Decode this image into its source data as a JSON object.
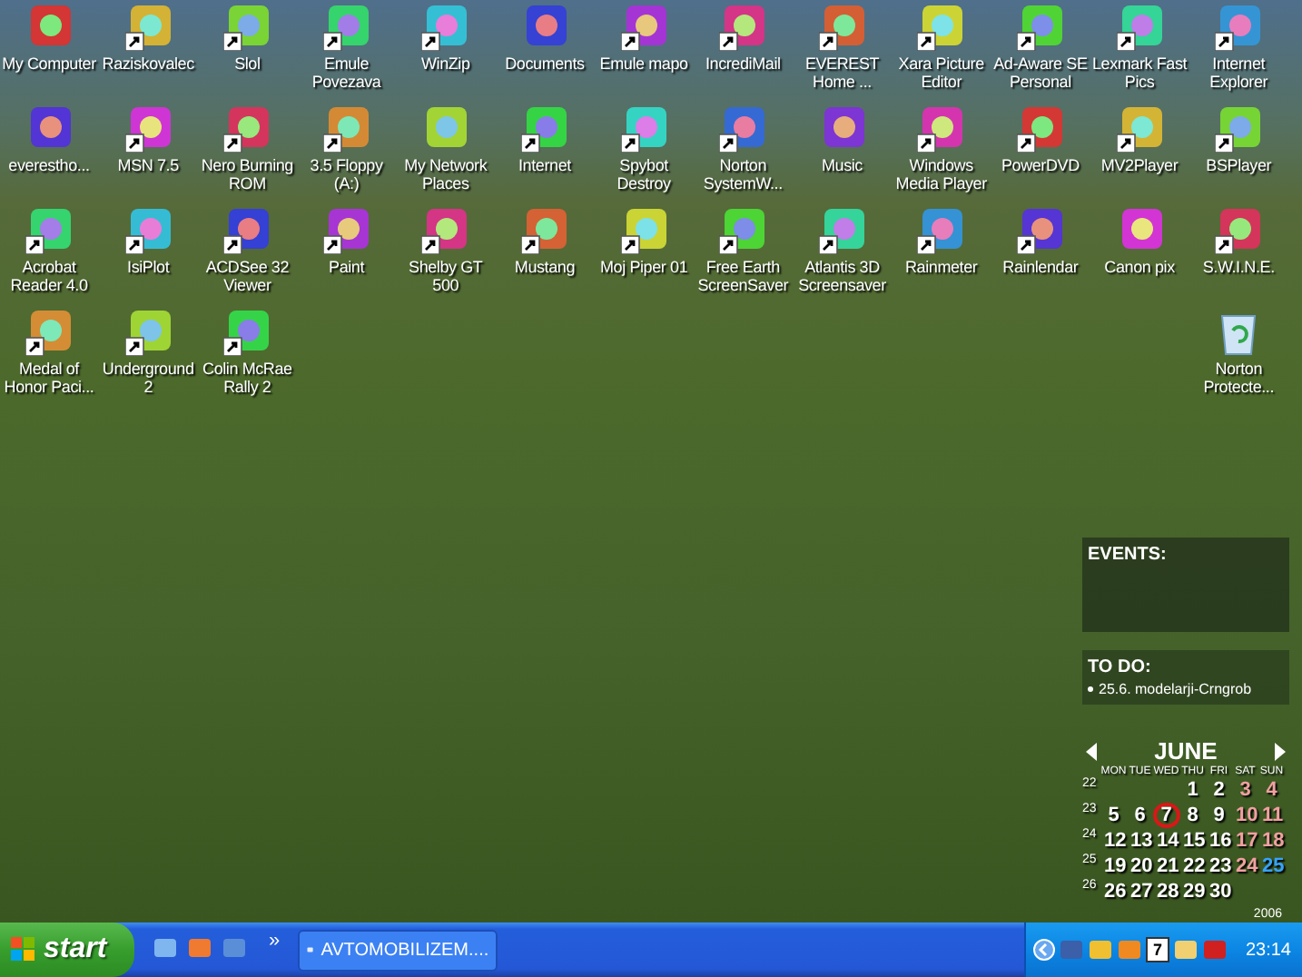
{
  "desktop": {
    "icon_rows": [
      [
        {
          "label": "My Computer",
          "kind": "item"
        },
        {
          "label": "Raziskovalec",
          "kind": "shortcut"
        },
        {
          "label": "Slol",
          "kind": "shortcut"
        },
        {
          "label": "Emule Povezava",
          "kind": "shortcut"
        },
        {
          "label": "WinZip",
          "kind": "shortcut"
        },
        {
          "label": "Documents",
          "kind": "item"
        },
        {
          "label": "Emule mapo",
          "kind": "shortcut"
        },
        {
          "label": "IncrediMail",
          "kind": "shortcut"
        },
        {
          "label": "EVEREST Home ...",
          "kind": "shortcut"
        },
        {
          "label": "Xara Picture Editor",
          "kind": "shortcut"
        },
        {
          "label": "Ad-Aware SE Personal",
          "kind": "shortcut"
        },
        {
          "label": "Lexmark Fast Pics",
          "kind": "shortcut"
        },
        {
          "label": "Internet Explorer",
          "kind": "shortcut"
        }
      ],
      [
        {
          "label": "everestho...",
          "kind": "item"
        },
        {
          "label": "MSN  7.5",
          "kind": "shortcut"
        },
        {
          "label": "Nero Burning ROM",
          "kind": "shortcut"
        },
        {
          "label": "3.5 Floppy (A:)",
          "kind": "shortcut"
        },
        {
          "label": "My Network Places",
          "kind": "item"
        },
        {
          "label": "Internet",
          "kind": "shortcut"
        },
        {
          "label": "Spybot Destroy",
          "kind": "shortcut"
        },
        {
          "label": "Norton SystemW...",
          "kind": "shortcut"
        },
        {
          "label": "Music",
          "kind": "item"
        },
        {
          "label": "Windows Media Player",
          "kind": "shortcut"
        },
        {
          "label": "PowerDVD",
          "kind": "shortcut"
        },
        {
          "label": "MV2Player",
          "kind": "shortcut"
        },
        {
          "label": "BSPlayer",
          "kind": "shortcut"
        }
      ],
      [
        {
          "label": "Acrobat Reader 4.0",
          "kind": "shortcut"
        },
        {
          "label": "IsiPlot",
          "kind": "shortcut"
        },
        {
          "label": "ACDSee 32 Viewer",
          "kind": "shortcut"
        },
        {
          "label": "Paint",
          "kind": "shortcut"
        },
        {
          "label": "Shelby GT 500",
          "kind": "shortcut"
        },
        {
          "label": "Mustang",
          "kind": "shortcut"
        },
        {
          "label": "Moj Piper 01",
          "kind": "shortcut"
        },
        {
          "label": "Free Earth ScreenSaver",
          "kind": "shortcut"
        },
        {
          "label": "Atlantis 3D Screensaver",
          "kind": "shortcut"
        },
        {
          "label": "Rainmeter",
          "kind": "shortcut"
        },
        {
          "label": "Rainlendar",
          "kind": "shortcut"
        },
        {
          "label": "Canon pix",
          "kind": "item"
        },
        {
          "label": "S.W.I.N.E.",
          "kind": "shortcut"
        }
      ],
      [
        {
          "label": "Medal of Honor Paci...",
          "kind": "shortcut"
        },
        {
          "label": "Underground 2",
          "kind": "shortcut"
        },
        {
          "label": "Colin McRae Rally 2",
          "kind": "shortcut"
        },
        {
          "label": "Norton Protecte...",
          "kind": "recycle_bin"
        }
      ]
    ]
  },
  "calendar": {
    "events_title": "EVENTS:",
    "todo_title": "TO DO:",
    "todo_items": [
      "25.6. modelarji-Crngrob"
    ],
    "month": "JUNE",
    "weekdays": [
      "MON",
      "TUE",
      "WED",
      "THU",
      "FRI",
      "SAT",
      "SUN"
    ],
    "year": "2006",
    "weeks": [
      {
        "number": "22",
        "days": [
          {
            "day": "1",
            "kind": "weekday",
            "selected": false
          },
          {
            "day": "2",
            "kind": "weekday",
            "selected": false
          },
          {
            "day": "3",
            "kind": "weekend",
            "selected": false
          },
          {
            "day": "4",
            "kind": "weekend",
            "selected": false
          }
        ]
      },
      {
        "number": "23",
        "days": [
          {
            "day": "5",
            "kind": "weekday",
            "selected": false
          },
          {
            "day": "6",
            "kind": "weekday",
            "selected": false
          },
          {
            "day": "7",
            "kind": "weekday",
            "selected": true
          },
          {
            "day": "8",
            "kind": "weekday",
            "selected": false
          },
          {
            "day": "9",
            "kind": "weekday",
            "selected": false
          },
          {
            "day": "10",
            "kind": "weekend",
            "selected": false
          },
          {
            "day": "11",
            "kind": "weekend",
            "selected": false
          }
        ]
      },
      {
        "number": "24",
        "days": [
          {
            "day": "12",
            "kind": "weekday",
            "selected": false
          },
          {
            "day": "13",
            "kind": "weekday",
            "selected": false
          },
          {
            "day": "14",
            "kind": "weekday",
            "selected": false
          },
          {
            "day": "15",
            "kind": "weekday",
            "selected": false
          },
          {
            "day": "16",
            "kind": "weekday",
            "selected": false
          },
          {
            "day": "17",
            "kind": "weekend",
            "selected": false
          },
          {
            "day": "18",
            "kind": "weekend",
            "selected": false
          }
        ]
      },
      {
        "number": "25",
        "days": [
          {
            "day": "19",
            "kind": "weekday",
            "selected": false
          },
          {
            "day": "20",
            "kind": "weekday",
            "selected": false
          },
          {
            "day": "21",
            "kind": "weekday",
            "selected": false
          },
          {
            "day": "22",
            "kind": "weekday",
            "selected": false
          },
          {
            "day": "23",
            "kind": "weekday",
            "selected": false
          },
          {
            "day": "24",
            "kind": "weekend",
            "selected": false
          },
          {
            "day": "25",
            "kind": "event",
            "selected": false
          }
        ]
      },
      {
        "number": "26",
        "days": [
          {
            "day": "26",
            "kind": "weekday",
            "selected": false
          },
          {
            "day": "27",
            "kind": "weekday",
            "selected": false
          },
          {
            "day": "28",
            "kind": "weekday",
            "selected": false
          },
          {
            "day": "29",
            "kind": "weekday",
            "selected": false
          },
          {
            "day": "30",
            "kind": "weekday",
            "selected": false
          }
        ]
      }
    ]
  },
  "taskbar": {
    "start": "start",
    "quick_launch_more": "»",
    "tasks": [
      {
        "label": "AVTOMOBILIZEM....",
        "selected": false
      }
    ],
    "tray_badge": "7",
    "clock": "23:14"
  }
}
